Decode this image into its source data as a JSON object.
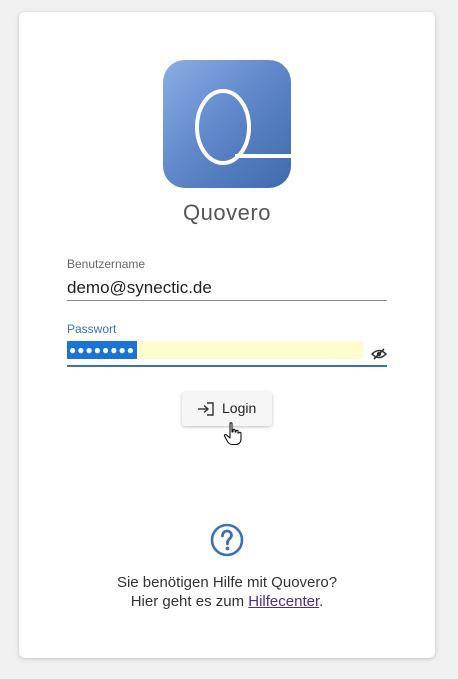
{
  "brand": {
    "name": "Quovero"
  },
  "form": {
    "username_label": "Benutzername",
    "username_value": "demo@synectic.de",
    "password_label": "Passwort",
    "password_masked": "●●●●●●●●"
  },
  "login": {
    "label": "Login"
  },
  "help": {
    "line1": "Sie benötigen Hilfe mit Quovero?",
    "line2_prefix": "Hier geht es zum ",
    "link_text": "Hilfecenter",
    "line2_suffix": "."
  },
  "icons": {
    "logo": "quovero-logo-icon",
    "eye": "eye-slash-icon",
    "login": "login-arrow-icon",
    "help": "question-circle-icon",
    "cursor": "hand-pointer-icon"
  },
  "colors": {
    "accent": "#3a72b8",
    "autofill": "#fffccf",
    "selection": "#1a73d6",
    "link": "#4b2d8a"
  }
}
